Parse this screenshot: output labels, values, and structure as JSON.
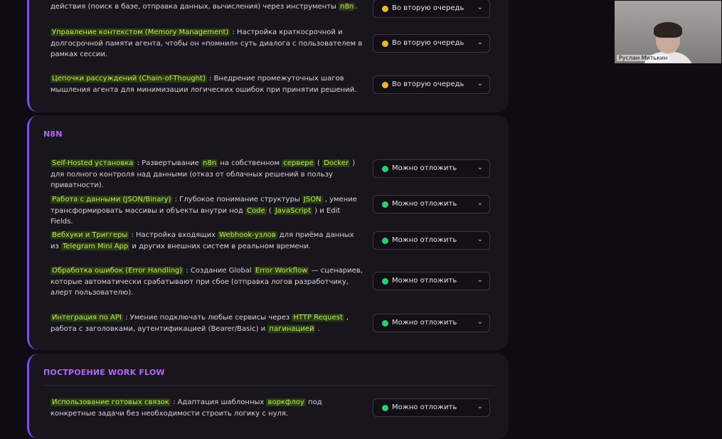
{
  "status": {
    "later_label": "Во вторую очередь",
    "postpone_label": "Можно отложить",
    "colors": {
      "yellow": "#e8b730",
      "green": "#2ecc71",
      "accent": "#7c4dff",
      "title": "#b565ff",
      "highlight": "#b8f05a"
    }
  },
  "card1": {
    "rows": [
      {
        "parts": [
          "действия (поиск в базе, отправка данных, вычисления) через инструменты ",
          "n8n",
          "."
        ]
      },
      {
        "parts": [
          "Управление контекстом (Memory Management)",
          " : Настройка краткосрочной и долгосрочной памяти агента, чтобы он «помнил» суть диалога с пользователем в рамках сессии."
        ]
      },
      {
        "parts": [
          "Цепочки рассуждений (Chain-of-Thought)",
          " : Внедрение промежуточных шагов мышления агента для минимизации логических ошибок при принятии решений."
        ]
      }
    ]
  },
  "card2": {
    "title": "N8N",
    "rows": [
      {
        "parts": [
          "Self-Hosted установка",
          " : Развертывание ",
          "n8n",
          " на собственном ",
          "сервере",
          " ( ",
          "Docker",
          " ) для полного контроля над данными (отказ от облачных решений в пользу приватности)."
        ]
      },
      {
        "parts": [
          "Работа с данными (JSON/Binary)",
          " : Глубокое понимание структуры ",
          "JSON",
          " , умение трансформировать массивы и объекты внутри нод ",
          "Code",
          " ( ",
          "JavaScript",
          " ) и Edit Fields."
        ]
      },
      {
        "parts": [
          "Вебхуки и Триггеры",
          " : Настройка входящих ",
          "Webhook-узлов",
          " для приёма данных из ",
          "Telegram Mini App",
          " и других внешних систем в реальном времени."
        ]
      },
      {
        "parts": [
          "Обработка ошибок (Error Handling)",
          " : Создание Global ",
          "Error Workflow",
          " — сценариев, которые автоматически срабатывают при сбое (отправка логов разработчику, алерт пользователю)."
        ]
      },
      {
        "parts": [
          "Интеграция по API",
          " : Умение подключать любые сервисы через ",
          "HTTP Request",
          " , работа с заголовками, аутентификацией (Bearer/Basic) и ",
          "пагинацией",
          " ."
        ]
      }
    ]
  },
  "card3": {
    "title": "ПОСТРОЕНИЕ WORK FLOW",
    "rows": [
      {
        "parts": [
          "Использование готовых связок",
          " : Адаптация шаблонных ",
          "воркфлоу",
          " под конкретные задачи без необходимости строить логику с нуля."
        ]
      }
    ]
  },
  "webcam": {
    "name": "Руслан Митькин"
  }
}
